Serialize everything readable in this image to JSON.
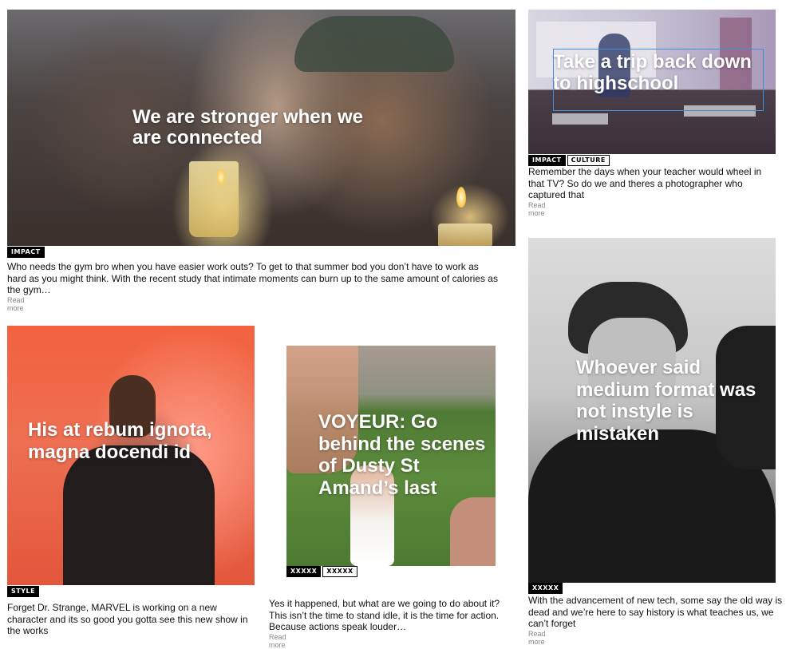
{
  "cards": {
    "gym": {
      "headline": "We are stronger when we are connected",
      "tags": [
        "IMPACT"
      ],
      "excerpt": "Who needs the gym bro when you have easier work outs? To get to that summer bod you don’t have to work as hard as you might think. With the recent study that intimate moments can burn up to the same amount of calories as the gym…",
      "read_more": "Read more"
    },
    "highschool": {
      "headline": "Take a trip back down to highschool",
      "tags": [
        "IMPACT",
        "CULTURE"
      ],
      "excerpt": "Remember the days when your teacher would wheel in that TV? So do we and theres a photographer who captured that",
      "read_more": "Read more"
    },
    "marvel": {
      "headline": "His at rebum ignota, magna docendi id",
      "tags": [
        "STYLE"
      ],
      "excerpt": "Forget Dr. Strange, MARVEL is working on a new character and its so good you gotta see this new show in the works"
    },
    "voyeur": {
      "headline": "VOYEUR: Go behind the scenes of Dusty St Amand’s last",
      "tags": [
        "XXXXX",
        "XXXXX"
      ],
      "excerpt": "Yes it happened, but what are we going to do about it? This isn’t the time to stand idle, it is the time for action. Because actions speak louder…",
      "read_more": "Read more"
    },
    "medium": {
      "headline": "Whoever said medium format was not instyle is mistaken",
      "tags": [
        "XXXXX"
      ],
      "excerpt": "With the advancement of new tech, some say the old way is dead and we’re here to say history is what teaches us, we can’t forget",
      "read_more": "Read more"
    }
  }
}
